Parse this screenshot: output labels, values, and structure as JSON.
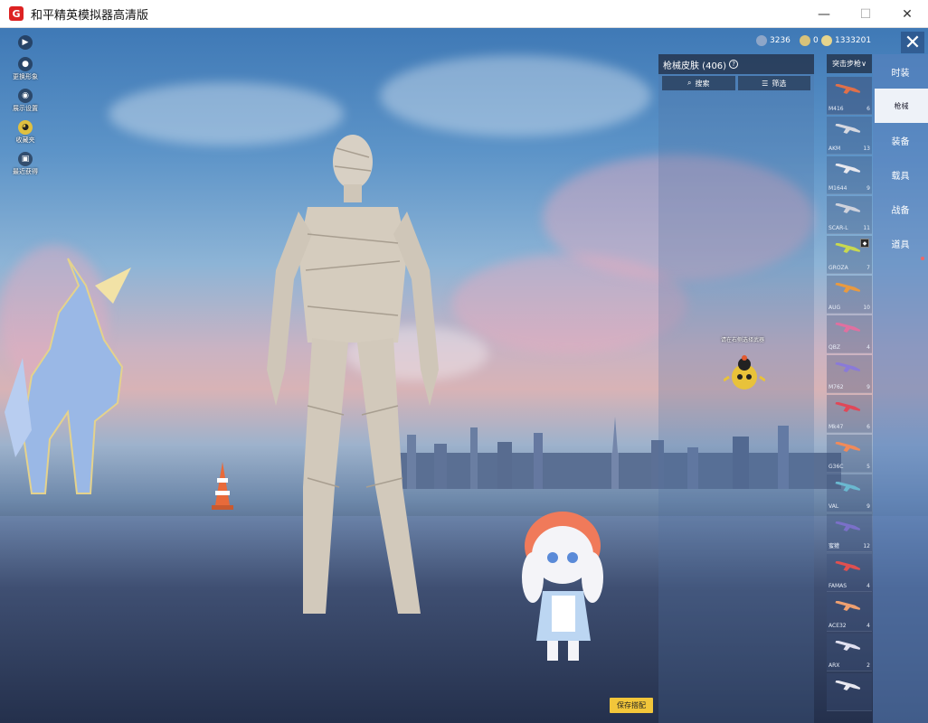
{
  "window": {
    "title": "和平精英模拟器高清版",
    "icon_letter": "G",
    "minimize_glyph": "—",
    "maximize_glyph": "☐",
    "close_glyph": "✕"
  },
  "left_menu": [
    {
      "icon": "play-icon",
      "glyph": "▶",
      "label": ""
    },
    {
      "icon": "avatar-icon",
      "glyph": "●",
      "label": "更换形象"
    },
    {
      "icon": "eye-icon",
      "glyph": "◉",
      "label": "展示设置"
    },
    {
      "icon": "owl-icon",
      "glyph": "◕",
      "label": "收藏夹"
    },
    {
      "icon": "gift-icon",
      "glyph": "▣",
      "label": "最近获得"
    }
  ],
  "currency": [
    {
      "icon": "coin-icon",
      "value": "3236",
      "color": "#8ea6c8"
    },
    {
      "icon": "token-icon",
      "value": "0",
      "color": "#d8c27a"
    },
    {
      "icon": "gem-icon",
      "value": "1333201",
      "color": "#e6d48c"
    }
  ],
  "close_button_glyph": "✕",
  "skin_panel": {
    "title": "枪械皮肤 (406)",
    "help_glyph": "?",
    "search_label": "搜索",
    "search_glyph": "⌕",
    "filter_label": "筛选",
    "filter_glyph": "☰"
  },
  "category_select": {
    "value": "突击步枪",
    "arrow": "∨"
  },
  "weapons": [
    {
      "name": "M416",
      "count": "6",
      "color": "#e0704a",
      "badge": ""
    },
    {
      "name": "AKM",
      "count": "13",
      "color": "#d6d8e0",
      "badge": ""
    },
    {
      "name": "M1644",
      "count": "9",
      "color": "#e8e8ee",
      "badge": ""
    },
    {
      "name": "SCAR-L",
      "count": "11",
      "color": "#cfd2dc",
      "badge": ""
    },
    {
      "name": "GROZA",
      "count": "7",
      "color": "#c8d850",
      "badge": "◆"
    },
    {
      "name": "AUG",
      "count": "10",
      "color": "#e89a40",
      "badge": ""
    },
    {
      "name": "QBZ",
      "count": "4",
      "color": "#e070a0",
      "badge": ""
    },
    {
      "name": "M762",
      "count": "9",
      "color": "#8a7ad8",
      "badge": ""
    },
    {
      "name": "Mk47",
      "count": "6",
      "color": "#e04858",
      "badge": ""
    },
    {
      "name": "G36C",
      "count": "5",
      "color": "#f08a5a",
      "badge": ""
    },
    {
      "name": "VAL",
      "count": "9",
      "color": "#6ab8d0",
      "badge": ""
    },
    {
      "name": "蜜獾",
      "count": "12",
      "color": "#7a70c8",
      "badge": ""
    },
    {
      "name": "FAMAS",
      "count": "4",
      "color": "#e05050",
      "badge": ""
    },
    {
      "name": "ACE32",
      "count": "4",
      "color": "#f0a070",
      "badge": ""
    },
    {
      "name": "ARX",
      "count": "2",
      "color": "#e0e0f0",
      "badge": ""
    },
    {
      "name": "",
      "count": "",
      "color": "#e8e8f0",
      "badge": ""
    }
  ],
  "right_tabs": [
    {
      "label": "时装",
      "active": false
    },
    {
      "label": "枪械",
      "active": true
    },
    {
      "label": "装备",
      "active": false
    },
    {
      "label": "载具",
      "active": false
    },
    {
      "label": "战备",
      "active": false
    },
    {
      "label": "道具",
      "active": false
    }
  ],
  "character_hint": "请在右侧选择武器",
  "save_button": "保存搭配"
}
